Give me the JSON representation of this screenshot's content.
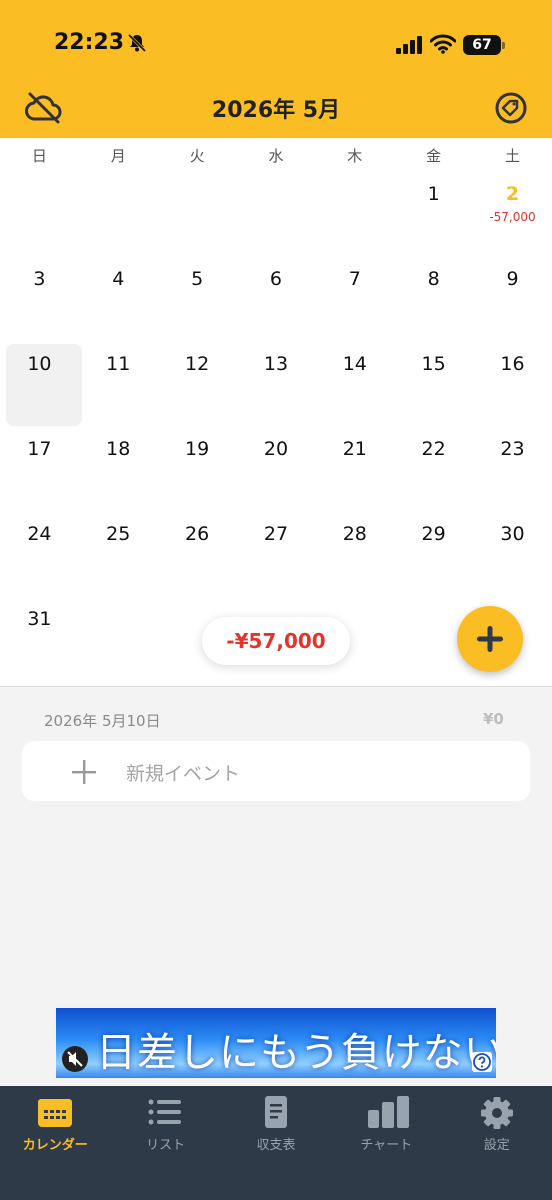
{
  "status_bar": {
    "time": "22:23",
    "battery": "67"
  },
  "header": {
    "title": "2026年 5月"
  },
  "calendar": {
    "weekdays": [
      "日",
      "月",
      "火",
      "水",
      "木",
      "金",
      "土"
    ],
    "weeks": [
      [
        {
          "d": ""
        },
        {
          "d": ""
        },
        {
          "d": ""
        },
        {
          "d": ""
        },
        {
          "d": ""
        },
        {
          "d": "1"
        },
        {
          "d": "2",
          "amount": "-57,000",
          "accent": true
        }
      ],
      [
        {
          "d": "3"
        },
        {
          "d": "4"
        },
        {
          "d": "5"
        },
        {
          "d": "6"
        },
        {
          "d": "7"
        },
        {
          "d": "8"
        },
        {
          "d": "9"
        }
      ],
      [
        {
          "d": "10",
          "selected": true
        },
        {
          "d": "11"
        },
        {
          "d": "12"
        },
        {
          "d": "13"
        },
        {
          "d": "14"
        },
        {
          "d": "15"
        },
        {
          "d": "16"
        }
      ],
      [
        {
          "d": "17"
        },
        {
          "d": "18"
        },
        {
          "d": "19"
        },
        {
          "d": "20"
        },
        {
          "d": "21"
        },
        {
          "d": "22"
        },
        {
          "d": "23"
        }
      ],
      [
        {
          "d": "24"
        },
        {
          "d": "25"
        },
        {
          "d": "26"
        },
        {
          "d": "27"
        },
        {
          "d": "28"
        },
        {
          "d": "29"
        },
        {
          "d": "30"
        }
      ],
      [
        {
          "d": "31"
        },
        {
          "d": ""
        },
        {
          "d": ""
        },
        {
          "d": ""
        },
        {
          "d": ""
        },
        {
          "d": ""
        },
        {
          "d": ""
        }
      ]
    ],
    "month_total": "-¥57,000"
  },
  "selected_day": {
    "date": "2026年 5月10日",
    "total": "¥0",
    "new_event_label": "新規イベント"
  },
  "ad": {
    "text": "日差しにもう負けない"
  },
  "tabs": [
    {
      "label": "カレンダー",
      "icon": "calendar-icon",
      "active": true
    },
    {
      "label": "リスト",
      "icon": "list-icon"
    },
    {
      "label": "収支表",
      "icon": "document-icon"
    },
    {
      "label": "チャート",
      "icon": "bar-chart-icon"
    },
    {
      "label": "設定",
      "icon": "gear-icon"
    }
  ],
  "colors": {
    "accent": "#fbbd24",
    "negative": "#e5342b",
    "tabbar": "#2f3a48"
  }
}
